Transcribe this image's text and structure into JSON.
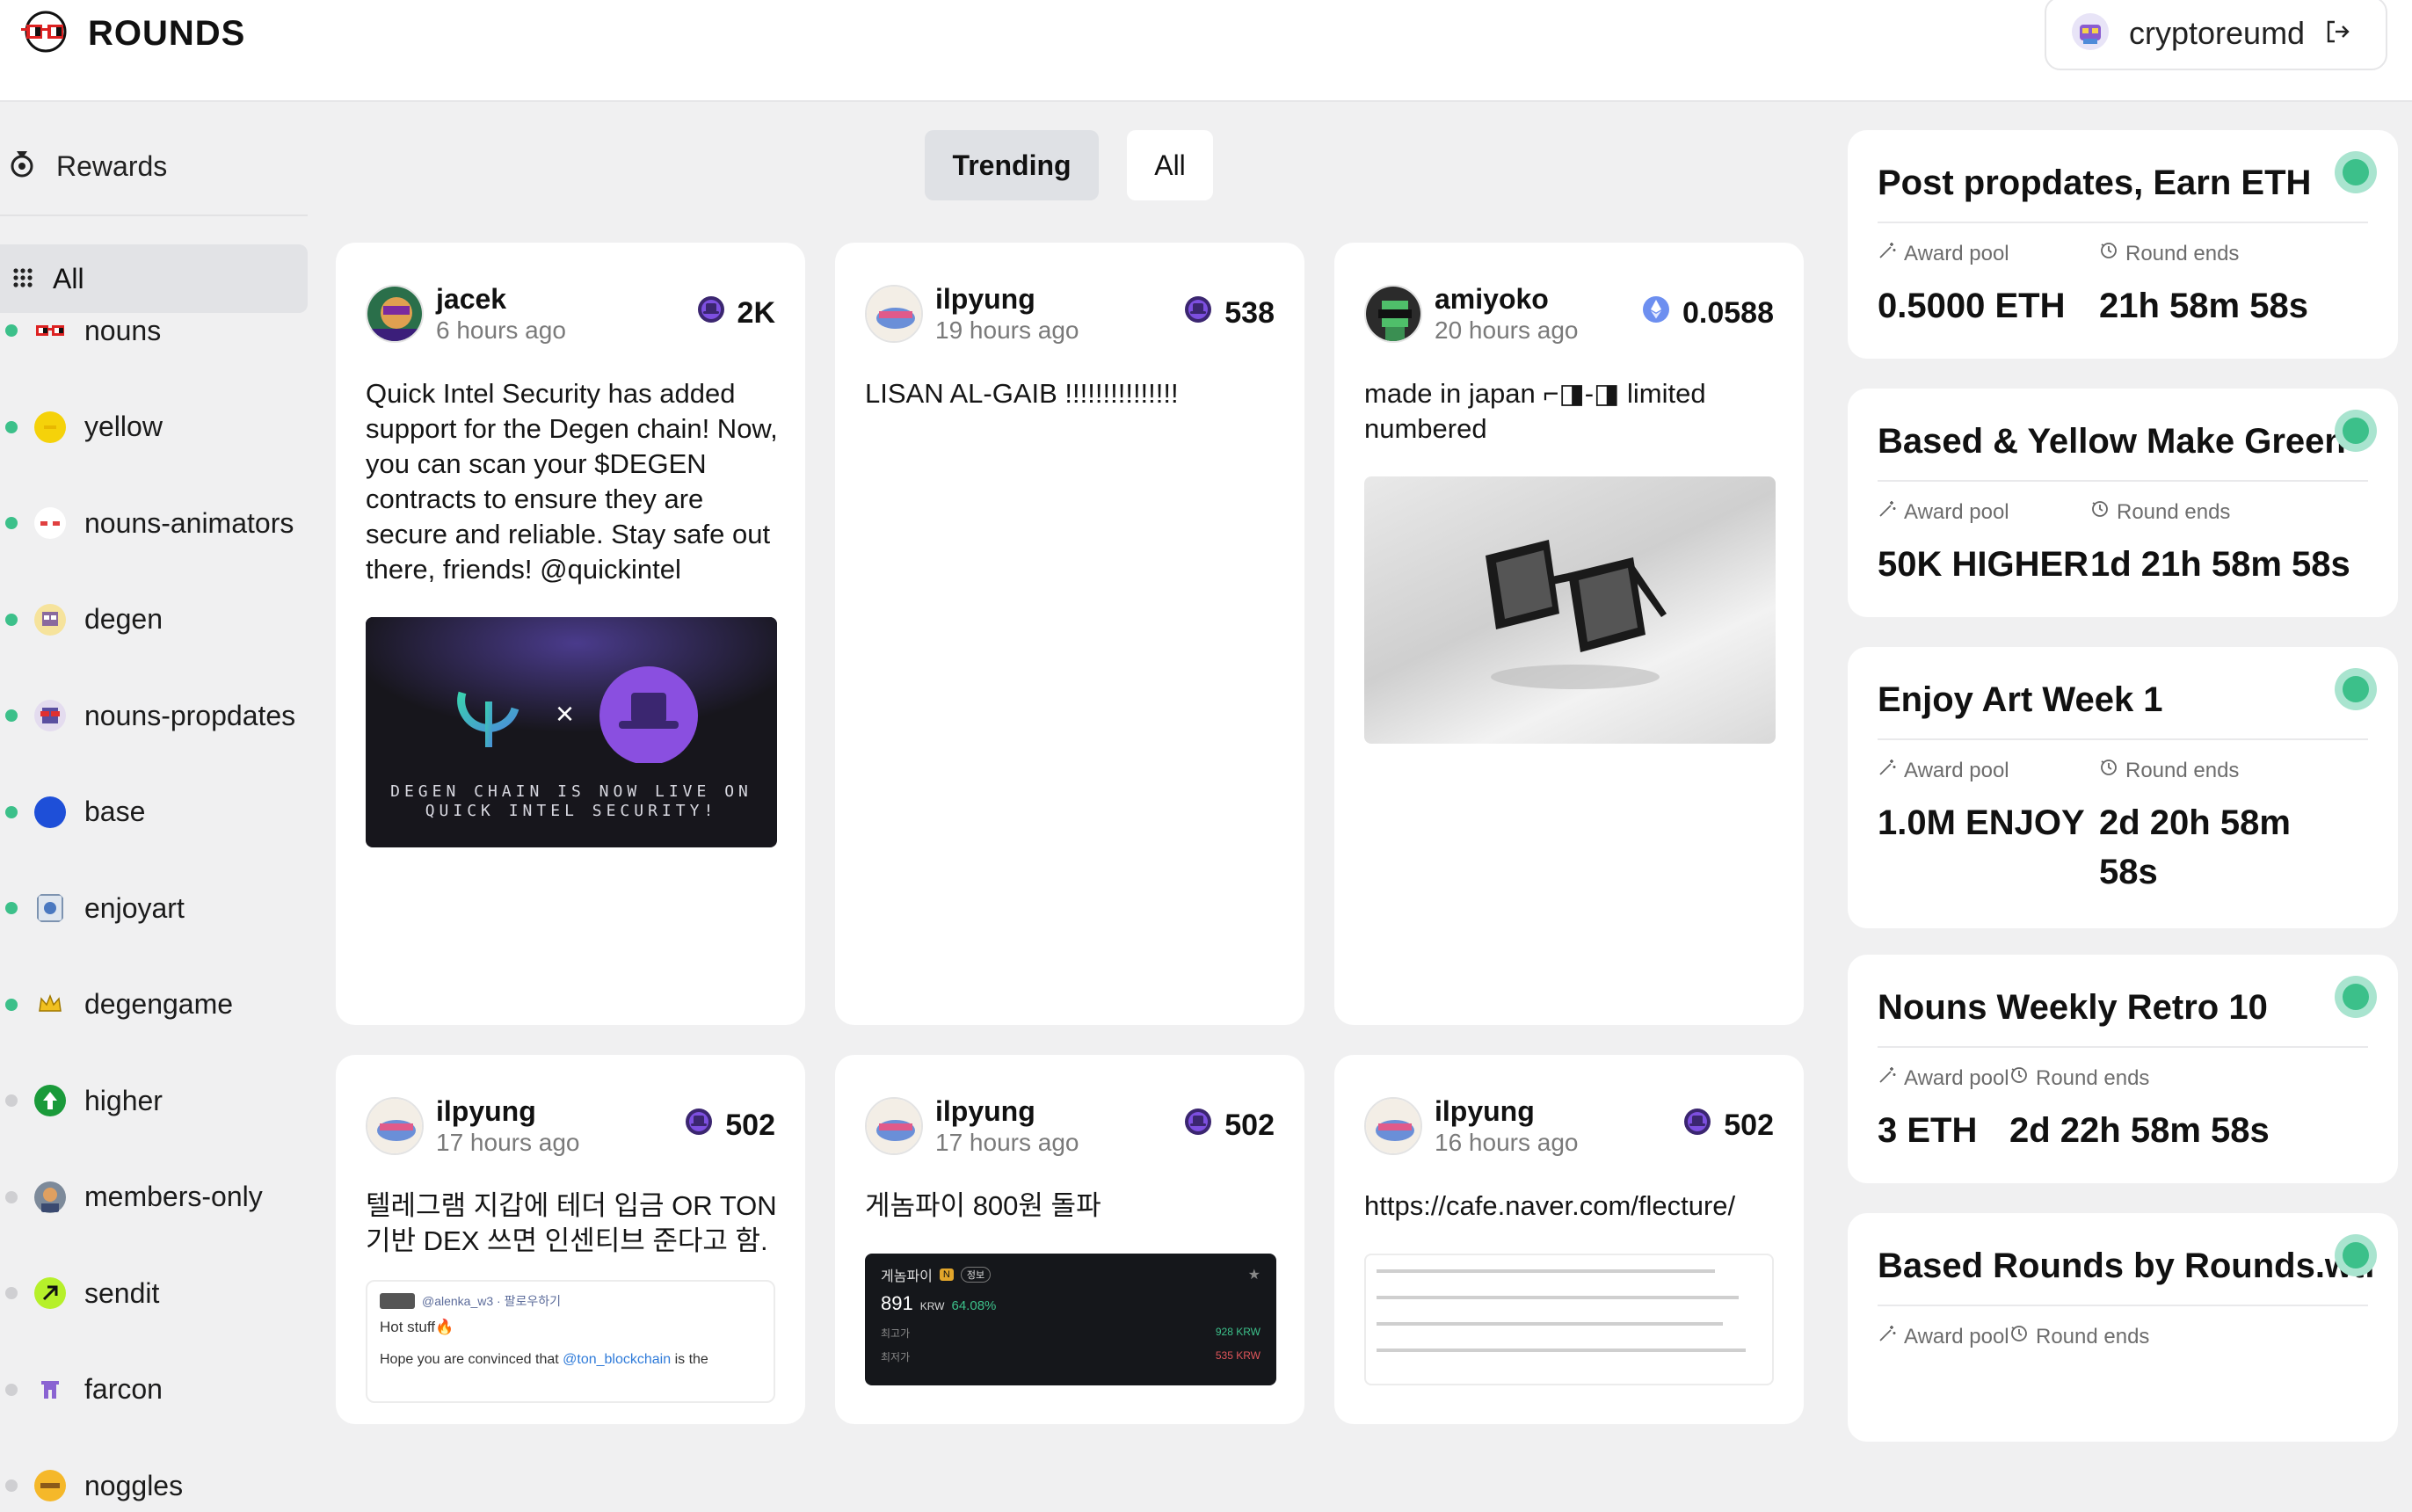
{
  "header": {
    "logo_text": "ROUNDS",
    "username": "cryptoreumd"
  },
  "sidebar": {
    "rewards_label": "Rewards",
    "all_label": "All",
    "channels": [
      {
        "name": "nouns",
        "dot": "#3cc08a"
      },
      {
        "name": "yellow",
        "dot": "#3cc08a"
      },
      {
        "name": "nouns-animators",
        "dot": "#3cc08a"
      },
      {
        "name": "degen",
        "dot": "#3cc08a"
      },
      {
        "name": "nouns-propdates",
        "dot": "#3cc08a"
      },
      {
        "name": "base",
        "dot": "#3cc08a"
      },
      {
        "name": "enjoyart",
        "dot": "#3cc08a"
      },
      {
        "name": "degengame",
        "dot": "#3cc08a"
      },
      {
        "name": "higher",
        "dot": "#cfcfd2"
      },
      {
        "name": "members-only",
        "dot": "#cfcfd2"
      },
      {
        "name": "sendit",
        "dot": "#cfcfd2"
      },
      {
        "name": "farcon",
        "dot": "#cfcfd2"
      },
      {
        "name": "noggles",
        "dot": "#cfcfd2"
      }
    ]
  },
  "tabs": {
    "trending": "Trending",
    "all": "All"
  },
  "posts": [
    {
      "user": "jacek",
      "time": "6 hours ago",
      "score": "2K",
      "score_icon": "degen-hat-icon",
      "text": "Quick Intel Security has added support for the Degen chain! Now, you can scan your $DEGEN contracts to ensure they are secure and reliable. Stay safe out there, friends! @quickintel",
      "image_caption": "DEGEN CHAIN IS NOW LIVE ON QUICK INTEL SECURITY!"
    },
    {
      "user": "ilpyung",
      "time": "19 hours ago",
      "score": "538",
      "score_icon": "degen-hat-icon",
      "text": "LISAN AL-GAIB !!!!!!!!!!!!!!!"
    },
    {
      "user": "amiyoko",
      "time": "20 hours ago",
      "score": "0.0588",
      "score_icon": "eth-icon",
      "text": "made in japan ⌐◨-◨ limited numbered"
    },
    {
      "user": "ilpyung",
      "time": "17 hours ago",
      "score": "502",
      "score_icon": "degen-hat-icon",
      "text": "텔레그램 지갑에 테더 입금 OR TON 기반 DEX 쓰면 인센티브 준다고 함.",
      "embed": {
        "handle": "@alenka_w3 · 팔로우하기",
        "line1": "Hot stuff🔥",
        "line2a": "Hope you are convinced that ",
        "line2b": "@ton_blockchain",
        "line2c": " is the"
      }
    },
    {
      "user": "ilpyung",
      "time": "17 hours ago",
      "score": "502",
      "score_icon": "degen-hat-icon",
      "text": "게놈파이 800원 돌파",
      "embed": {
        "name": "게놈파이",
        "badge1": "N",
        "badge2": "정보",
        "price": "891",
        "unit": "KRW",
        "pct": "64.08%",
        "hi_label": "최고가",
        "lo_label": "최저가",
        "hi": "928 KRW",
        "lo": "535 KRW"
      }
    },
    {
      "user": "ilpyung",
      "time": "16 hours ago",
      "score": "502",
      "score_icon": "degen-hat-icon",
      "text": "https://cafe.naver.com/flecture/"
    }
  ],
  "rounds": [
    {
      "title": "Post propdates, Earn ETH",
      "pool_label": "Award pool",
      "ends_label": "Round ends",
      "pool": "0.5000 ETH",
      "ends": "21h 58m 58s"
    },
    {
      "title": "Based & Yellow Make Green",
      "pool_label": "Award pool",
      "ends_label": "Round ends",
      "pool": "50K HIGHER",
      "ends": "1d 21h 58m 58s"
    },
    {
      "title": "Enjoy Art Week 1",
      "pool_label": "Award pool",
      "ends_label": "Round ends",
      "pool": "1.0M ENJOY",
      "ends": "2d 20h 58m 58s"
    },
    {
      "title": "Nouns Weekly Retro 10",
      "pool_label": "Award pool",
      "ends_label": "Round ends",
      "pool": "3 ETH",
      "ends": "2d 22h 58m 58s"
    },
    {
      "title": "Based Rounds by Rounds.wtf",
      "pool_label": "Award pool",
      "ends_label": "Round ends",
      "pool": "",
      "ends": ""
    }
  ]
}
